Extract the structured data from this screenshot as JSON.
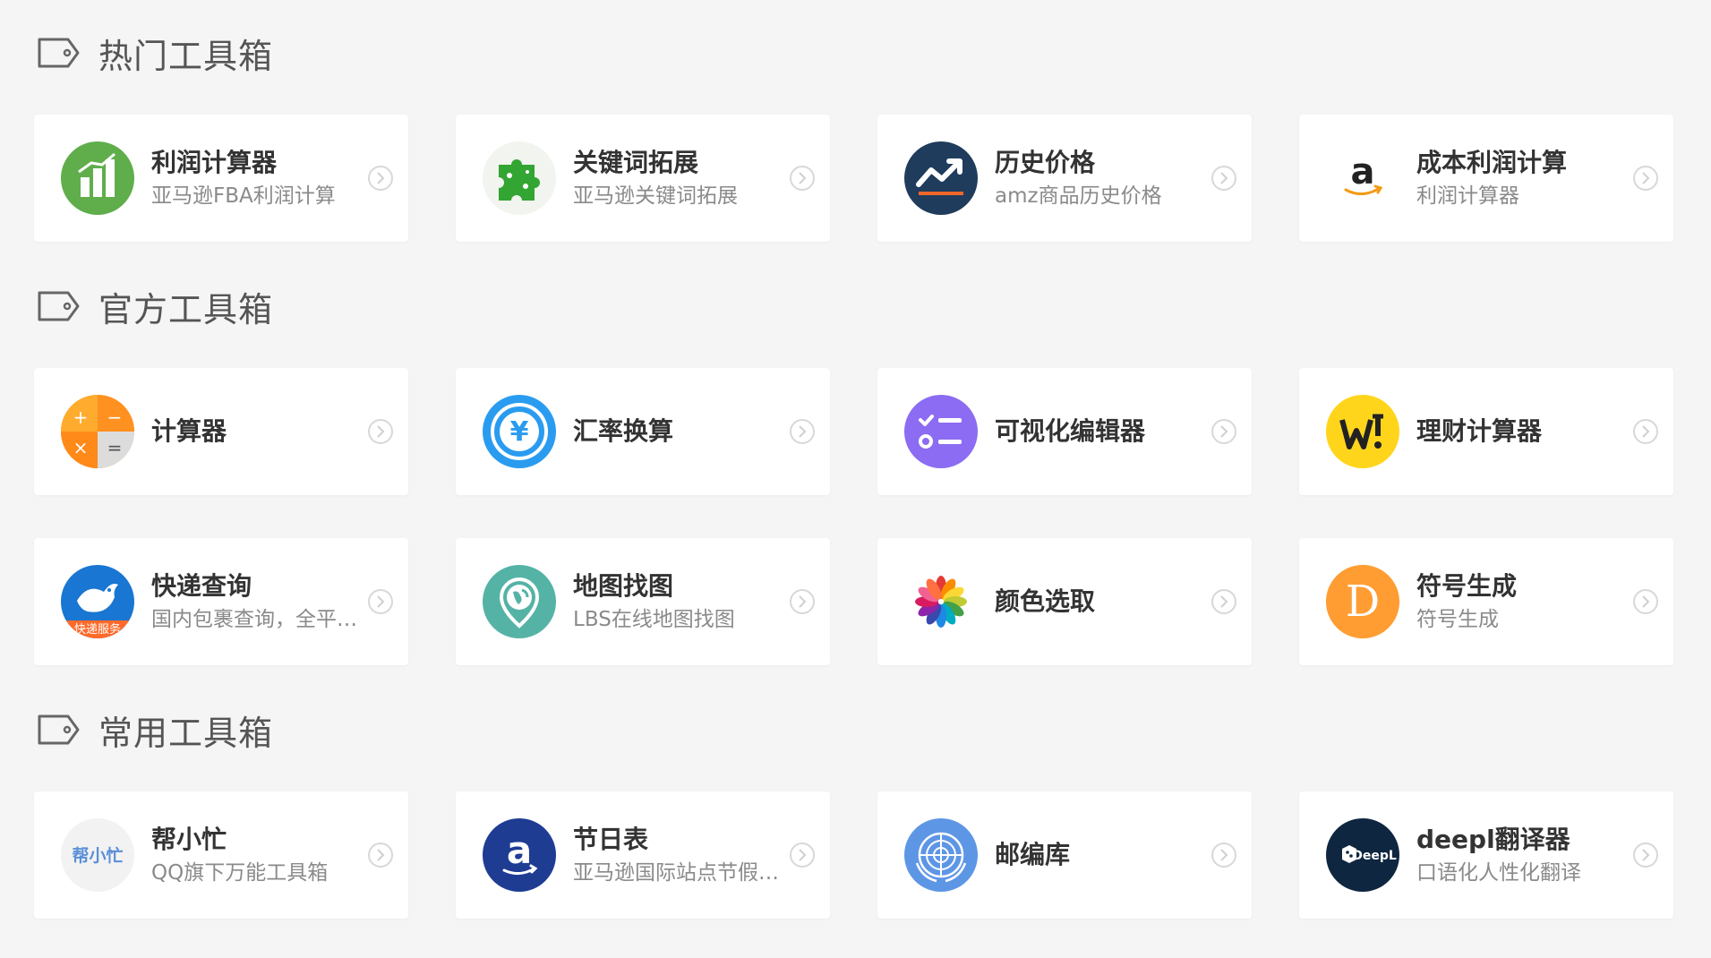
{
  "sections": [
    {
      "title": "热门工具箱",
      "items": [
        {
          "title": "利润计算器",
          "desc": "亚马逊FBA利润计算",
          "icon": "bar-chart-icon",
          "color": "#5fae4b"
        },
        {
          "title": "关键词拓展",
          "desc": "亚马逊关键词拓展",
          "icon": "puzzle-icon",
          "color": "#33a532"
        },
        {
          "title": "历史价格",
          "desc": "amz商品历史价格",
          "icon": "trend-line-icon",
          "color": "#1f3c5c"
        },
        {
          "title": "成本利润计算",
          "desc": "利润计算器",
          "icon": "amazon-logo-icon",
          "color": "#ffffff"
        }
      ]
    },
    {
      "title": "官方工具箱",
      "items": [
        {
          "title": "计算器",
          "desc": "",
          "icon": "calculator-icon",
          "color": "#ff9d1e"
        },
        {
          "title": "汇率换算",
          "desc": "",
          "icon": "yuan-exchange-icon",
          "color": "#2a9cf0"
        },
        {
          "title": "可视化编辑器",
          "desc": "",
          "icon": "checklist-icon",
          "color": "#8b6cf2"
        },
        {
          "title": "理财计算器",
          "desc": "",
          "icon": "finance-icon",
          "color": "#ffd51c"
        },
        {
          "title": "快递查询",
          "desc": "国内包裹查询，全平…",
          "icon": "bird-delivery-icon",
          "color": "#1976d2"
        },
        {
          "title": "地图找图",
          "desc": "LBS在线地图找图",
          "icon": "map-pin-icon",
          "color": "#55b3a6"
        },
        {
          "title": "颜色选取",
          "desc": "",
          "icon": "color-wheel-icon",
          "color": "#ffffff"
        },
        {
          "title": "符号生成",
          "desc": "符号生成",
          "icon": "letter-d-icon",
          "color": "#ff9d33"
        }
      ]
    },
    {
      "title": "常用工具箱",
      "items": [
        {
          "title": "帮小忙",
          "desc": "QQ旗下万能工具箱",
          "icon": "bangxiaomang-logo-icon",
          "color": "#f2f2f2"
        },
        {
          "title": "节日表",
          "desc": "亚马逊国际站点节假…",
          "icon": "amazon-a-icon",
          "color": "#1f3c93"
        },
        {
          "title": "邮编库",
          "desc": "",
          "icon": "un-globe-icon",
          "color": "#5e96e6"
        },
        {
          "title": "deepl翻译器",
          "desc": "口语化人性化翻译",
          "icon": "deepl-logo-icon",
          "color": "#0e2640"
        }
      ]
    }
  ],
  "icon_text": {
    "bang": "帮小忙",
    "express": "快递服务",
    "deepl": "DeepL",
    "calc_plus": "+",
    "calc_minus": "−",
    "calc_times": "×",
    "calc_eq": "=",
    "letter_d": "D",
    "letter_a": "a",
    "yuan": "¥"
  }
}
